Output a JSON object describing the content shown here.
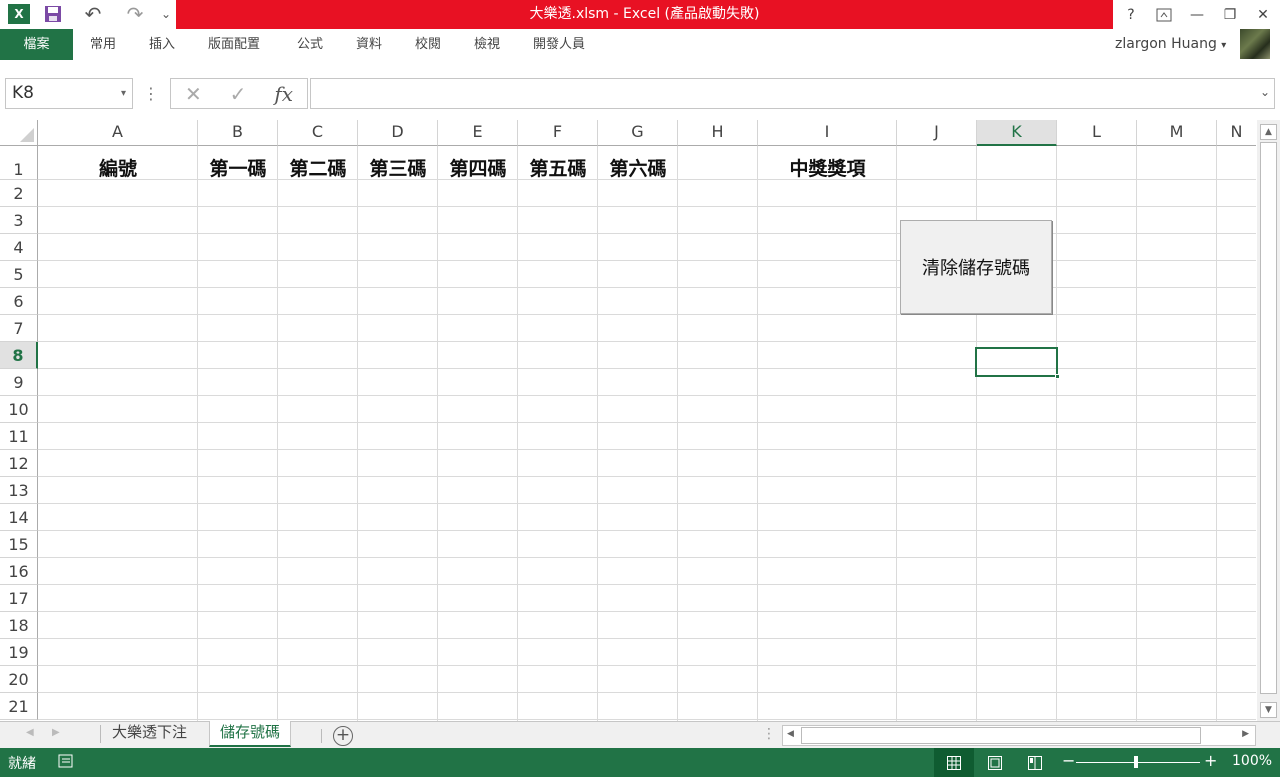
{
  "window": {
    "title": "大樂透.xlsm -  Excel (產品啟動失敗)",
    "help": "?",
    "minimize": "—",
    "restore": "❐",
    "close": "✕"
  },
  "qat": {
    "app_icon": "X",
    "save": "save-icon",
    "undo": "↶",
    "redo": "↷",
    "more": "⌄"
  },
  "ribbon": {
    "file": "檔案",
    "tabs": [
      "常用",
      "插入",
      "版面配置",
      "公式",
      "資料",
      "校閱",
      "檢視",
      "開發人員"
    ],
    "user": "zlargon Huang"
  },
  "formula_bar": {
    "name_box": "K8",
    "fx": "fx",
    "value": ""
  },
  "columns": [
    "A",
    "B",
    "C",
    "D",
    "E",
    "F",
    "G",
    "H",
    "I",
    "J",
    "K",
    "L",
    "M",
    "N"
  ],
  "rows": [
    "1",
    "2",
    "3",
    "4",
    "5",
    "6",
    "7",
    "8",
    "9",
    "10",
    "11",
    "12",
    "13",
    "14",
    "15",
    "16",
    "17",
    "18",
    "19",
    "20",
    "21"
  ],
  "row1": {
    "A": "編號",
    "B": "第一碼",
    "C": "第二碼",
    "D": "第三碼",
    "E": "第四碼",
    "F": "第五碼",
    "G": "第六碼",
    "I": "中獎獎項"
  },
  "selected": {
    "column": "K",
    "row": "8"
  },
  "button": {
    "label": "清除儲存號碼"
  },
  "sheets": {
    "tabs": [
      "大樂透下注",
      "儲存號碼"
    ],
    "active": "儲存號碼"
  },
  "status": {
    "mode": "就緒",
    "zoom": "100%"
  },
  "colors": {
    "accent": "#217346",
    "title_error": "#e81123"
  }
}
